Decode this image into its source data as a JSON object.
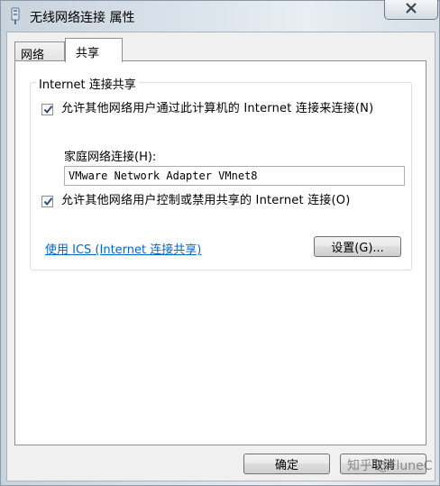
{
  "window": {
    "title": "无线网络连接 属性",
    "close_glyph": "✕"
  },
  "tabs": [
    {
      "label": "网络",
      "active": false
    },
    {
      "label": "共享",
      "active": true
    }
  ],
  "sharing": {
    "group_title": "Internet 连接共享",
    "allow_connect": {
      "label": "允许其他网络用户通过此计算机的 Internet 连接来连接(N)",
      "checked": true
    },
    "home_network_label": "家庭网络连接(H):",
    "home_network_value": "VMware Network Adapter VMnet8",
    "allow_control": {
      "label": "允许其他网络用户控制或禁用共享的 Internet 连接(O)",
      "checked": true
    },
    "help_link": "使用 ICS (Internet 连接共享)",
    "settings_button": "设置(G)..."
  },
  "footer": {
    "ok": "确定",
    "cancel": "取消"
  },
  "watermark": "知乎 @FluneC",
  "colors": {
    "link": "#0066cc",
    "check": "#1f3f6e"
  }
}
